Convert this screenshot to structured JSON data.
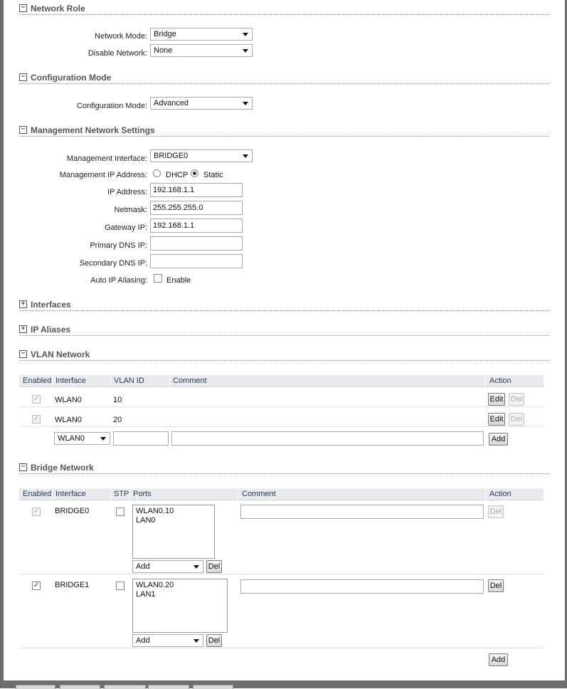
{
  "network_role": {
    "title": "Network Role",
    "network_mode_label": "Network Mode:",
    "network_mode_value": "Bridge",
    "disable_network_label": "Disable Network:",
    "disable_network_value": "None"
  },
  "configuration_mode": {
    "title": "Configuration Mode",
    "label": "Configuration Mode:",
    "value": "Advanced"
  },
  "management": {
    "title": "Management Network Settings",
    "interface_label": "Management Interface:",
    "interface_value": "BRIDGE0",
    "ip_mode_label": "Management IP Address:",
    "dhcp_label": "DHCP",
    "static_label": "Static",
    "ip_label": "IP Address:",
    "ip_value": "192.168.1.1",
    "netmask_label": "Netmask:",
    "netmask_value": "255.255.255.0",
    "gateway_label": "Gateway IP:",
    "gateway_value": "192.168.1.1",
    "primary_dns_label": "Primary DNS IP:",
    "primary_dns_value": "",
    "secondary_dns_label": "Secondary DNS IP:",
    "secondary_dns_value": "",
    "aliasing_label": "Auto IP Aliasing:",
    "aliasing_enable_label": "Enable"
  },
  "interfaces": {
    "title": "Interfaces"
  },
  "ip_aliases": {
    "title": "IP Aliases"
  },
  "vlan": {
    "title": "VLAN Network",
    "headers": {
      "enabled": "Enabled",
      "interface": "Interface",
      "vlan_id": "VLAN ID",
      "comment": "Comment",
      "action": "Action"
    },
    "rows": [
      {
        "interface": "WLAN0",
        "vlan_id": "10",
        "comment": ""
      },
      {
        "interface": "WLAN0",
        "vlan_id": "20",
        "comment": ""
      }
    ],
    "new_row": {
      "interface": "WLAN0",
      "vlan_id": "",
      "comment": ""
    },
    "edit_label": "Edit",
    "del_label": "Del",
    "add_label": "Add"
  },
  "bridge": {
    "title": "Bridge Network",
    "headers": {
      "enabled": "Enabled",
      "interface": "Interface",
      "stp": "STP",
      "ports": "Ports",
      "comment": "Comment",
      "action": "Action"
    },
    "rows": [
      {
        "interface": "BRIDGE0",
        "ports": [
          "WLAN0.10",
          "LAN0"
        ],
        "port_select": "Add",
        "comment": ""
      },
      {
        "interface": "BRIDGE1",
        "ports": [
          "WLAN0.20",
          "LAN1"
        ],
        "port_select": "Add",
        "comment": ""
      }
    ],
    "del_label": "Del",
    "add_label": "Add"
  }
}
